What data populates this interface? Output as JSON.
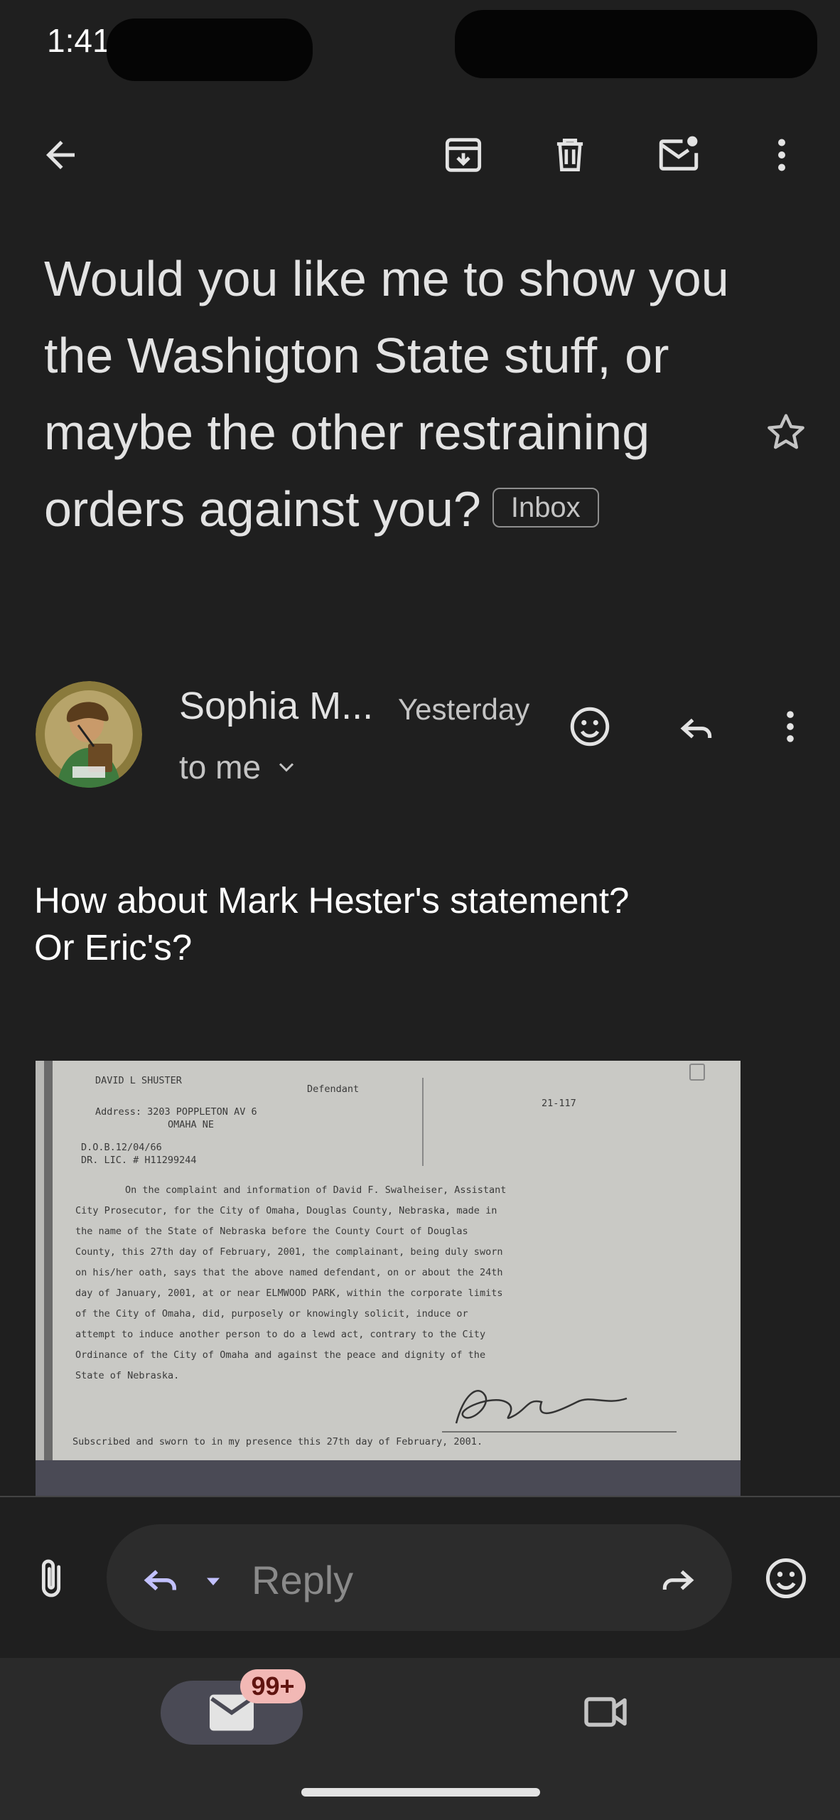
{
  "status_bar": {
    "time": "1:41"
  },
  "toolbar": {
    "back_icon": "arrow-left-icon",
    "archive_icon": "archive-icon",
    "delete_icon": "trash-icon",
    "unread_icon": "mark-unread-icon",
    "more_icon": "more-vert-icon"
  },
  "email": {
    "subject": "Would you like me to show you the Washigton State stuff, or maybe the other restraining orders against you?",
    "label": "Inbox",
    "sender": {
      "name": "Sophia M...",
      "time": "Yesterday",
      "recipients": "to me"
    },
    "body": {
      "line1": "How about Mark Hester's statement?",
      "line2": "Or Eric's?"
    }
  },
  "document": {
    "name_line": "DAVID L SHUSTER",
    "defendant_label": "Defendant",
    "address_line": "Address: 3203 POPPLETON AV 6",
    "city_line": "OMAHA NE",
    "case_no": "21-117",
    "dob_line": "D.O.B.12/04/66",
    "license_line": "DR. LIC. # H11299244",
    "paragraph": [
      "On the complaint and information of David F. Swalheiser, Assistant",
      "City Prosecutor, for the City of Omaha, Douglas County, Nebraska, made in",
      "the name of the State of Nebraska before the County Court of Douglas",
      "County, this 27th day of February, 2001, the complainant, being duly sworn",
      "on his/her oath, says that the above named defendant, on or about the 24th",
      "day of January, 2001, at or near ELMWOOD PARK, within the corporate limits",
      "of the City of Omaha, did, purposely or knowingly solicit, induce or",
      "attempt to induce another person to do a lewd act, contrary to the City",
      "Ordinance of the City of Omaha and against the peace and dignity of the",
      "State of Nebraska."
    ],
    "sworn_line": "Subscribed and sworn to in my presence this 27th day of February, 2001."
  },
  "reply_bar": {
    "placeholder": "Reply"
  },
  "bottom_nav": {
    "badge": "99+"
  },
  "colors": {
    "background": "#1f1f1f",
    "text": "#e3e3e3",
    "pill": "#2c2c2c",
    "badge_bg": "#f2b8b5",
    "accent": "#c2c1ff"
  }
}
